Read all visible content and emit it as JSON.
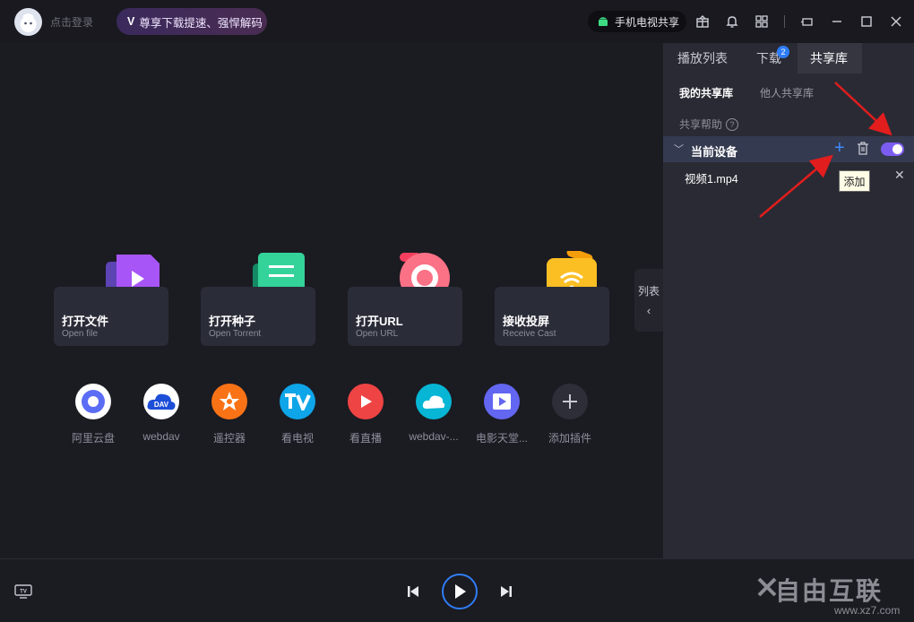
{
  "topbar": {
    "login_text": "点击登录",
    "vip_label": "尊享下载提速、强悍解码",
    "tv_share_label": "手机电视共享"
  },
  "main": {
    "cards": [
      {
        "title": "打开文件",
        "subtitle": "Open file",
        "icon": "video-file-icon",
        "color": "#a855f7"
      },
      {
        "title": "打开种子",
        "subtitle": "Open Torrent",
        "icon": "torrent-icon",
        "color": "#34d399"
      },
      {
        "title": "打开URL",
        "subtitle": "Open URL",
        "icon": "url-icon",
        "color": "#fb7185"
      },
      {
        "title": "接收投屏",
        "subtitle": "Receive Cast",
        "icon": "cast-icon",
        "color": "#fbbf24"
      }
    ],
    "plugins": [
      {
        "label": "阿里云盘",
        "icon": "aliyun-drive-icon",
        "color": "#3b82f6"
      },
      {
        "label": "webdav",
        "icon": "webdav-icon",
        "color": "#ffffff"
      },
      {
        "label": "遥控器",
        "icon": "remote-icon",
        "color": "#f97316"
      },
      {
        "label": "看电视",
        "icon": "tv-icon",
        "color": "#0ea5e9"
      },
      {
        "label": "看直播",
        "icon": "live-icon",
        "color": "#ef4444"
      },
      {
        "label": "webdav-...",
        "icon": "webdav-cloud-icon",
        "color": "#06b6d4"
      },
      {
        "label": "电影天堂...",
        "icon": "movie-icon",
        "color": "#6366f1"
      },
      {
        "label": "添加插件",
        "icon": "add-plugin-icon",
        "color": "#2e2e38"
      }
    ],
    "list_toggle_label": "列表"
  },
  "panel": {
    "tabs": [
      "播放列表",
      "下载",
      "共享库"
    ],
    "download_badge": "2",
    "subtabs": [
      "我的共享库",
      "他人共享库"
    ],
    "help_label": "共享帮助",
    "device_label": "当前设备",
    "file_name": "视频1.mp4",
    "tooltip": "添加",
    "toggle_on": true
  },
  "watermark": {
    "text": "自由互联",
    "url": "www.xz7.com"
  }
}
